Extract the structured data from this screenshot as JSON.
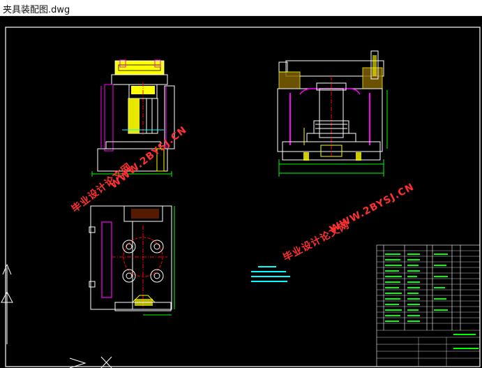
{
  "window": {
    "title": "夹具装配图.dwg"
  },
  "watermarks": [
    {
      "text": "WWW.2BYSJ.CN"
    },
    {
      "text": "毕业设计论文网"
    },
    {
      "text": "WWW.2BYSJ.CN"
    },
    {
      "text": "毕业设计论文网"
    }
  ],
  "colors": {
    "background": "#000000",
    "outline": "#ffffff",
    "yellow_part": "#ffff00",
    "green_part": "#00ff00",
    "magenta_part": "#ff00ff",
    "cyan_dim": "#00ffff",
    "centerline": "#ff0000",
    "watermark": "#ff3030"
  },
  "icons": [
    "ucs-y-arrow-icon",
    "ucs-x-arrow-icon",
    "ucs-origin-cross-icon"
  ]
}
